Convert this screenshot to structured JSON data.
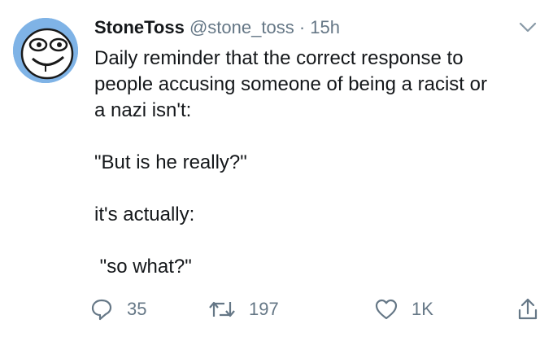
{
  "tweet": {
    "author": {
      "display_name": "StoneToss",
      "handle": "@stone_toss",
      "separator": "·",
      "time": "15h"
    },
    "body_lines": [
      "Daily reminder that the correct response to",
      "people accusing someone of being a racist or",
      "a nazi isn't:",
      "",
      "\"But is he really?\"",
      "",
      "it's actually:",
      "",
      " \"so what?\""
    ],
    "actions": {
      "reply_count": "35",
      "retweet_count": "197",
      "like_count": "1K"
    },
    "icons": {
      "reply": "reply-icon",
      "retweet": "retweet-icon",
      "like": "heart-icon",
      "share": "share-icon",
      "menu": "chevron-down-icon"
    },
    "colors": {
      "text": "#14171a",
      "secondary": "#657786",
      "avatar_bg": "#7fb3e6"
    }
  }
}
